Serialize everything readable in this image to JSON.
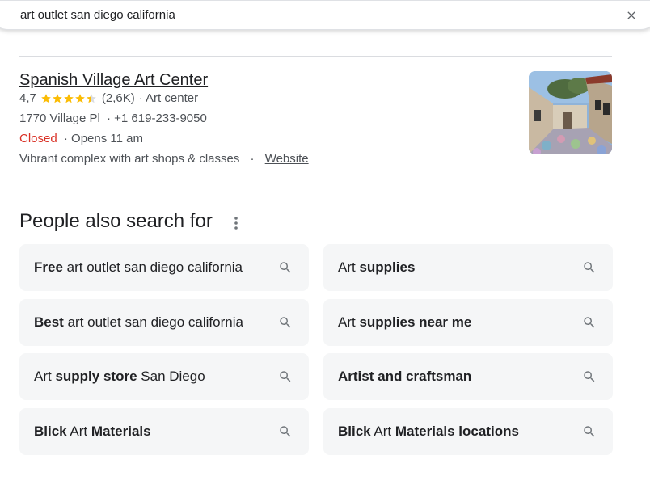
{
  "search": {
    "query": "art outlet san diego california"
  },
  "place": {
    "name": "Spanish Village Art Center",
    "rating": "4,7",
    "stars": 4.5,
    "reviews": "(2,6K)",
    "category": "· Art center",
    "address": "1770 Village Pl",
    "phone": "· +1 619-233-9050",
    "status": "Closed",
    "opens": "· Opens 11 am",
    "description": "Vibrant complex with art shops & classes",
    "separator": "·",
    "website_label": "Website"
  },
  "people_also_search": {
    "title": "People also search for",
    "items": [
      {
        "parts": [
          {
            "t": "Free",
            "b": true
          },
          {
            "t": " art outlet san diego california",
            "b": false
          }
        ]
      },
      {
        "parts": [
          {
            "t": "Art ",
            "b": false
          },
          {
            "t": "supplies",
            "b": true
          }
        ]
      },
      {
        "parts": [
          {
            "t": "Best",
            "b": true
          },
          {
            "t": " art outlet san diego california",
            "b": false
          }
        ]
      },
      {
        "parts": [
          {
            "t": "Art ",
            "b": false
          },
          {
            "t": "supplies near me",
            "b": true
          }
        ]
      },
      {
        "parts": [
          {
            "t": "Art ",
            "b": false
          },
          {
            "t": "supply store",
            "b": true
          },
          {
            "t": " San Diego",
            "b": false
          }
        ]
      },
      {
        "parts": [
          {
            "t": "Artist and craftsman",
            "b": true
          }
        ]
      },
      {
        "parts": [
          {
            "t": "Blick",
            "b": true
          },
          {
            "t": " Art ",
            "b": false
          },
          {
            "t": "Materials",
            "b": true
          }
        ]
      },
      {
        "parts": [
          {
            "t": "Blick",
            "b": true
          },
          {
            "t": " Art ",
            "b": false
          },
          {
            "t": "Materials locations",
            "b": true
          }
        ]
      }
    ]
  },
  "colors": {
    "star": "#fbbc04",
    "closed": "#d93025",
    "chip_bg": "#f5f6f7"
  },
  "icons": {
    "close": "close-icon",
    "more": "more-vert-icon",
    "search": "search-icon",
    "star": "star-icon"
  }
}
